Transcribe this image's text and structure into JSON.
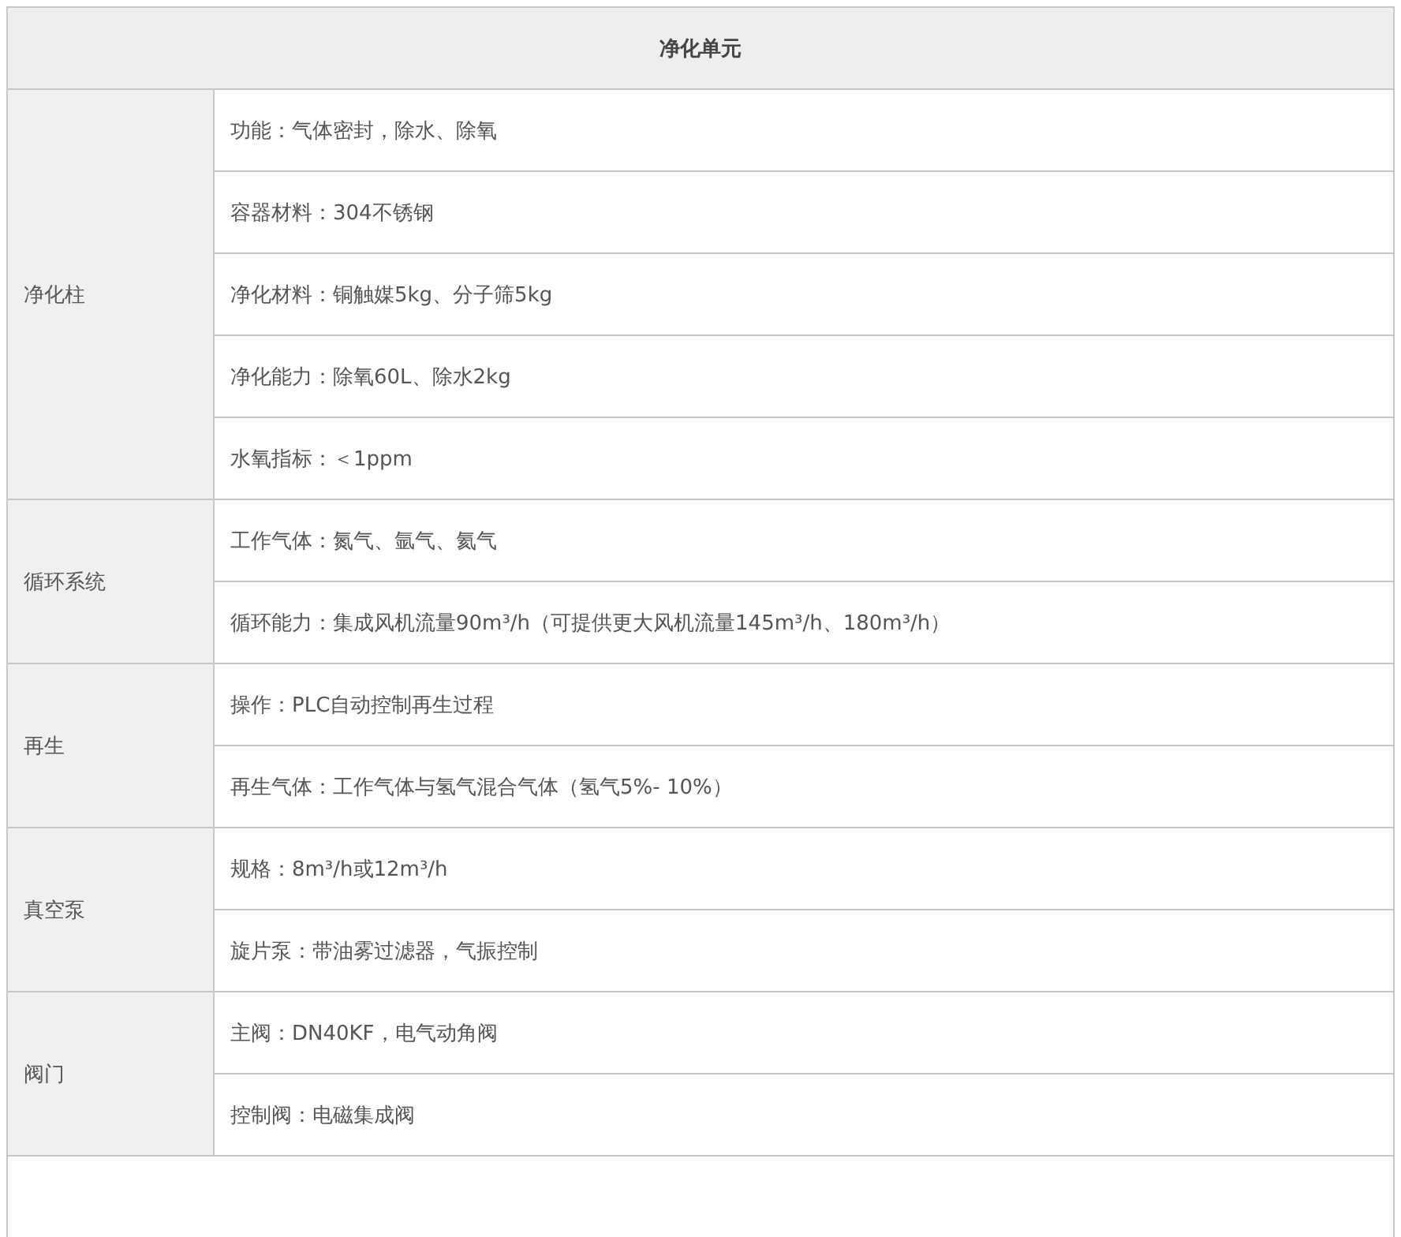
{
  "table": {
    "title": "净化单元",
    "groups": [
      {
        "name": "净化柱",
        "items": [
          "功能：气体密封，除水、除氧",
          "容器材料：304不锈钢",
          "净化材料：铜触媒5kg、分子筛5kg",
          "净化能力：除氧60L、除水2kg",
          "水氧指标：＜1ppm"
        ]
      },
      {
        "name": "循环系统",
        "items": [
          "工作气体：氮气、氩气、氦气",
          "循环能力：集成风机流量90m³/h（可提供更大风机流量145m³/h、180m³/h）"
        ]
      },
      {
        "name": "再生",
        "items": [
          "操作：PLC自动控制再生过程",
          "再生气体：工作气体与氢气混合气体（氢气5%- 10%）"
        ]
      },
      {
        "name": "真空泵",
        "items": [
          "规格：8m³/h或12m³/h",
          "旋片泵：带油雾过滤器，气振控制"
        ]
      },
      {
        "name": "阀门",
        "items": [
          "主阀：DN40KF，电气动角阀",
          "控制阀：电磁集成阀"
        ]
      }
    ]
  }
}
